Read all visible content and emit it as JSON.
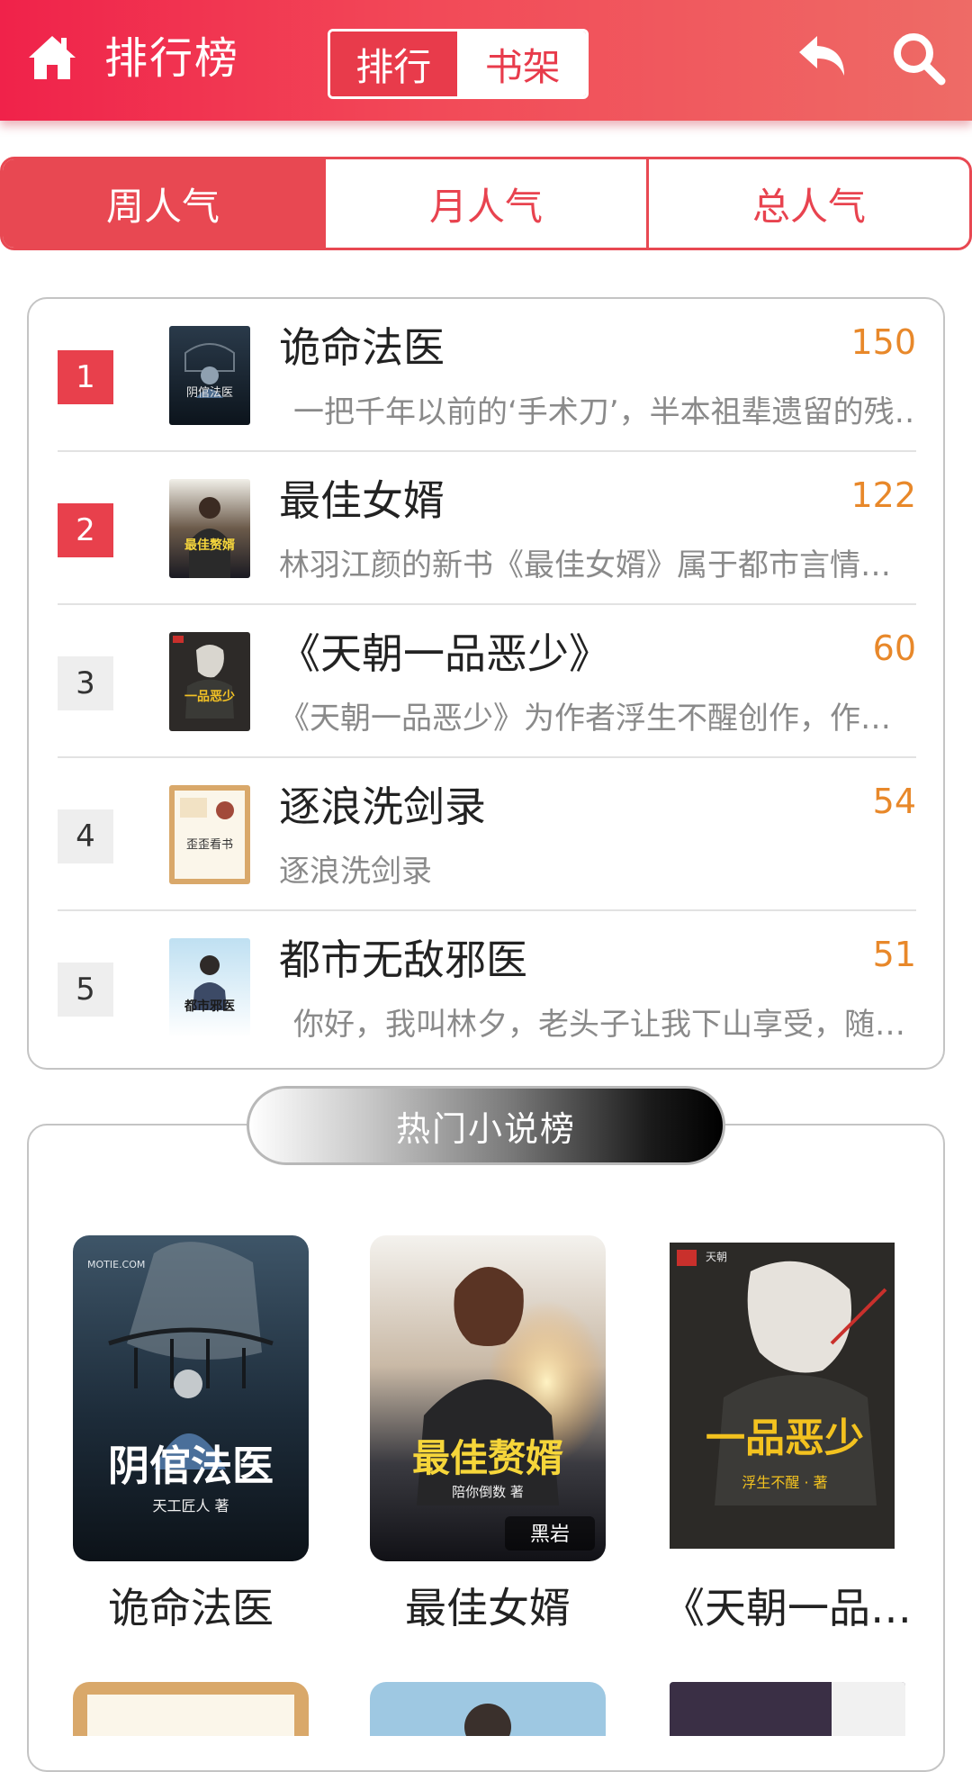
{
  "header": {
    "title": "排行榜",
    "segments": [
      "排行",
      "书架"
    ],
    "active_segment": "排行",
    "icons": [
      "home-icon",
      "back-icon",
      "search-icon"
    ]
  },
  "period_tabs": [
    "周人气",
    "月人气",
    "总人气"
  ],
  "active_period": "周人气",
  "ranking": [
    {
      "rank": "1",
      "title": "诡命法医",
      "score": "150",
      "desc": "一把千年以前的‘手术刀’，半本祖辈遗留的残…",
      "cover_text": "阴倌法医"
    },
    {
      "rank": "2",
      "title": "最佳女婿",
      "score": "122",
      "desc": "林羽江颜的新书《最佳女婿》属于都市言情…",
      "cover_text": "最佳赘婿"
    },
    {
      "rank": "3",
      "title": "《天朝一品恶少》",
      "score": "60",
      "desc": "《天朝一品恶少》为作者浮生不醒创作，作…",
      "cover_text": "一品恶少"
    },
    {
      "rank": "4",
      "title": "逐浪洗剑录",
      "score": "54",
      "desc": "逐浪洗剑录",
      "cover_text": "歪歪看书"
    },
    {
      "rank": "5",
      "title": "都市无敌邪医",
      "score": "51",
      "desc": "你好，我叫林夕，老头子让我下山享受，随…",
      "cover_text": "都市邪医"
    }
  ],
  "hot_section": {
    "title": "热门小说榜",
    "items": [
      {
        "name": "诡命法医",
        "cover_text": "阴倌法医",
        "cover_sub": "天工匠人 著",
        "cover_brand": "MOTIE.COM"
      },
      {
        "name": "最佳女婿",
        "cover_text": "最佳赘婿",
        "cover_sub": "陪你倒数 著",
        "cover_brand": "黑岩"
      },
      {
        "name": "《天朝一品…",
        "cover_text": "一品恶少",
        "cover_sub": "浮生不醒 · 著",
        "cover_brand": "天朝"
      }
    ]
  },
  "colors": {
    "brand_red": "#e8404c",
    "score_orange": "#e8882a",
    "header_gradient_start": "#f0224a",
    "header_gradient_end": "#ee6b66"
  }
}
